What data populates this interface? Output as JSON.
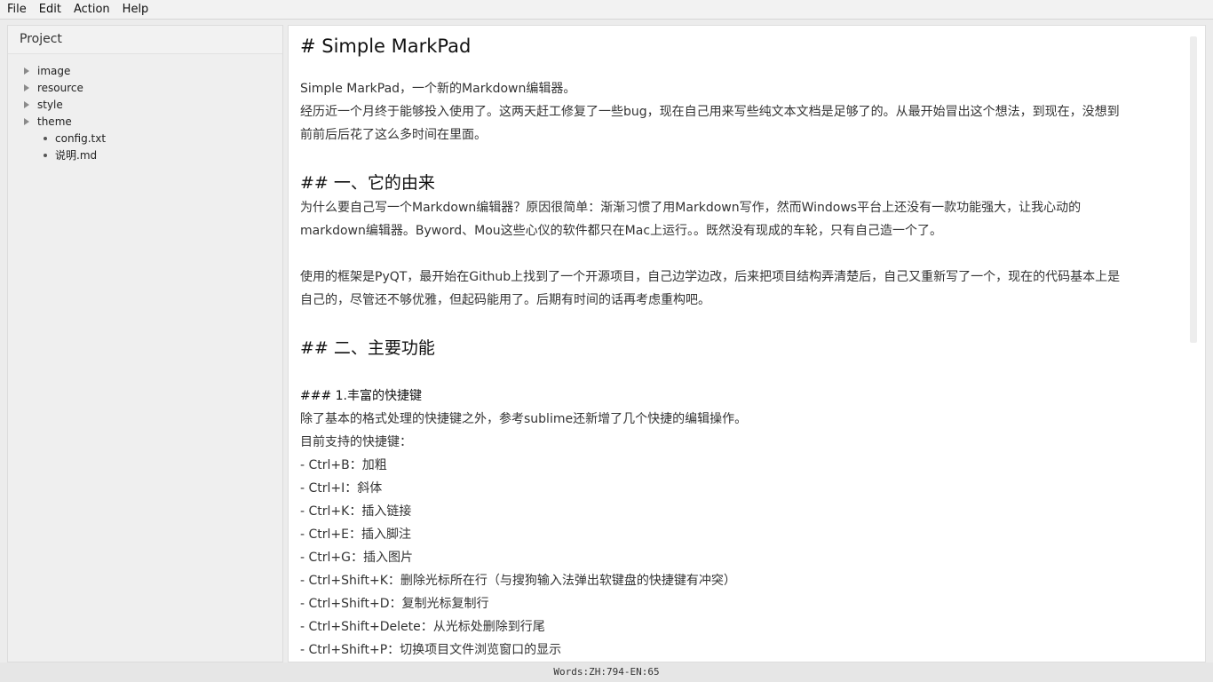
{
  "menu": [
    "File",
    "Edit",
    "Action",
    "Help"
  ],
  "sidebar": {
    "title": "Project",
    "folders": [
      "image",
      "resource",
      "style",
      "theme"
    ],
    "files": [
      "config.txt",
      "说明.md"
    ]
  },
  "editor": {
    "lines": [
      {
        "type": "h1",
        "text": "# Simple MarkPad"
      },
      {
        "type": "blank-s",
        "text": ""
      },
      {
        "type": "p",
        "text": "Simple MarkPad，一个新的Markdown编辑器。"
      },
      {
        "type": "p",
        "text": "经历近一个月终于能够投入使用了。这两天赶工修复了一些bug，现在自己用来写些纯文本文档是足够了的。从最开始冒出这个想法，到现在，没想到"
      },
      {
        "type": "p",
        "text": "前前后后花了这么多时间在里面。"
      },
      {
        "type": "blank",
        "text": ""
      },
      {
        "type": "h2",
        "text": "## 一、它的由来"
      },
      {
        "type": "p",
        "text": "为什么要自己写一个Markdown编辑器？原因很简单：渐渐习惯了用Markdown写作，然而Windows平台上还没有一款功能强大，让我心动的"
      },
      {
        "type": "p",
        "text": "markdown编辑器。Byword、Mou这些心仪的软件都只在Mac上运行。。既然没有现成的车轮，只有自己造一个了。"
      },
      {
        "type": "blank",
        "text": ""
      },
      {
        "type": "p",
        "text": "使用的框架是PyQT，最开始在Github上找到了一个开源项目，自己边学边改，后来把项目结构弄清楚后，自己又重新写了一个，现在的代码基本上是"
      },
      {
        "type": "p",
        "text": "自己的，尽管还不够优雅，但起码能用了。后期有时间的话再考虑重构吧。"
      },
      {
        "type": "blank",
        "text": ""
      },
      {
        "type": "h2",
        "text": "## 二、主要功能"
      },
      {
        "type": "blank",
        "text": ""
      },
      {
        "type": "h3",
        "text": "### 1.丰富的快捷键"
      },
      {
        "type": "p",
        "text": "除了基本的格式处理的快捷键之外，参考sublime还新增了几个快捷的编辑操作。"
      },
      {
        "type": "p",
        "text": "目前支持的快捷键："
      },
      {
        "type": "p",
        "text": "- Ctrl+B：加粗"
      },
      {
        "type": "p",
        "text": "- Ctrl+I：斜体"
      },
      {
        "type": "p",
        "text": "- Ctrl+K：插入链接"
      },
      {
        "type": "p",
        "text": "- Ctrl+E：插入脚注"
      },
      {
        "type": "p",
        "text": "- Ctrl+G：插入图片"
      },
      {
        "type": "p",
        "text": "- Ctrl+Shift+K：删除光标所在行（与搜狗输入法弹出软键盘的快捷键有冲突）"
      },
      {
        "type": "p",
        "text": "- Ctrl+Shift+D：复制光标复制行"
      },
      {
        "type": "p",
        "text": "- Ctrl+Shift+Delete：从光标处删除到行尾"
      },
      {
        "type": "p",
        "text": "- Ctrl+Shift+P：切换项目文件浏览窗口的显示"
      }
    ]
  },
  "status": {
    "word_count": "Words:ZH:794-EN:65"
  }
}
